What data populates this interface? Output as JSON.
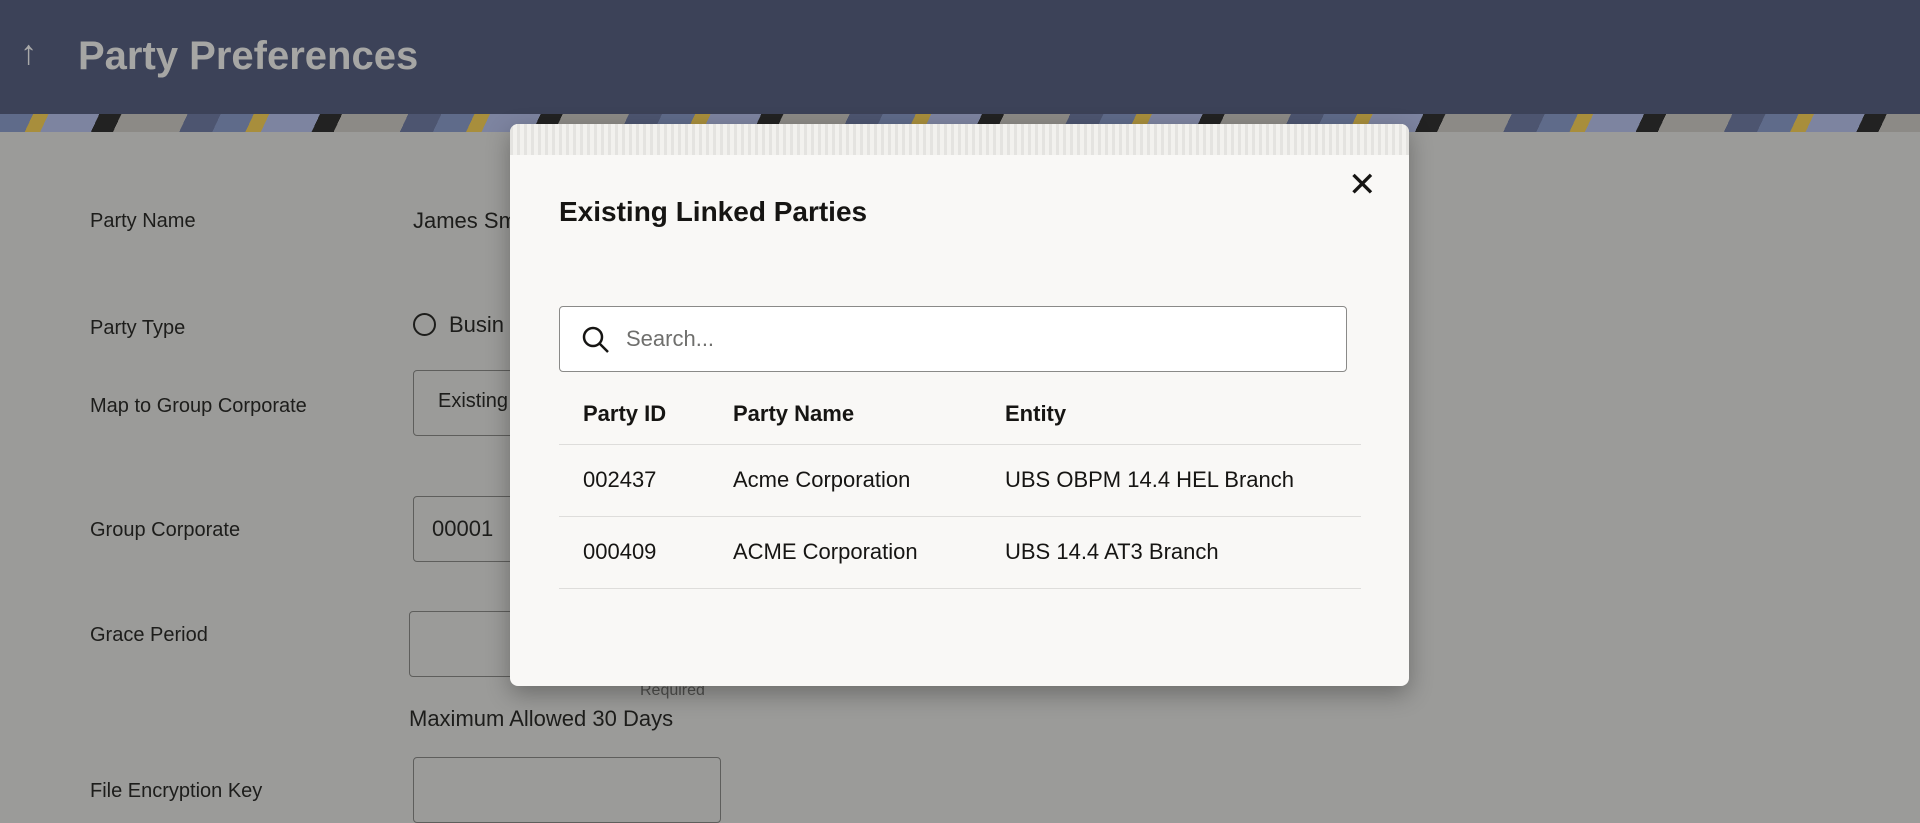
{
  "header": {
    "back_icon": "arrow-up-icon",
    "title": "Party Preferences"
  },
  "form": {
    "party_name_label": "Party Name",
    "party_name_value": "James Sm",
    "party_type_label": "Party Type",
    "party_type_option": "Busin",
    "map_label": "Map to Group Corporate",
    "map_value": "Existing",
    "group_corporate_label": "Group Corporate",
    "group_corporate_value": "00001",
    "grace_period_label": "Grace Period",
    "grace_required": "Required",
    "grace_hint": "Maximum Allowed 30 Days",
    "file_key_label": "File Encryption Key"
  },
  "modal": {
    "title": "Existing Linked Parties",
    "close_icon": "close-icon",
    "search_placeholder": "Search...",
    "columns": [
      "Party ID",
      "Party Name",
      "Entity"
    ],
    "rows": [
      [
        "002437",
        "Acme Corporation",
        "UBS OBPM 14.4 HEL Branch"
      ],
      [
        "000409",
        "ACME Corporation",
        "UBS 14.4 AT3 Branch"
      ]
    ]
  }
}
